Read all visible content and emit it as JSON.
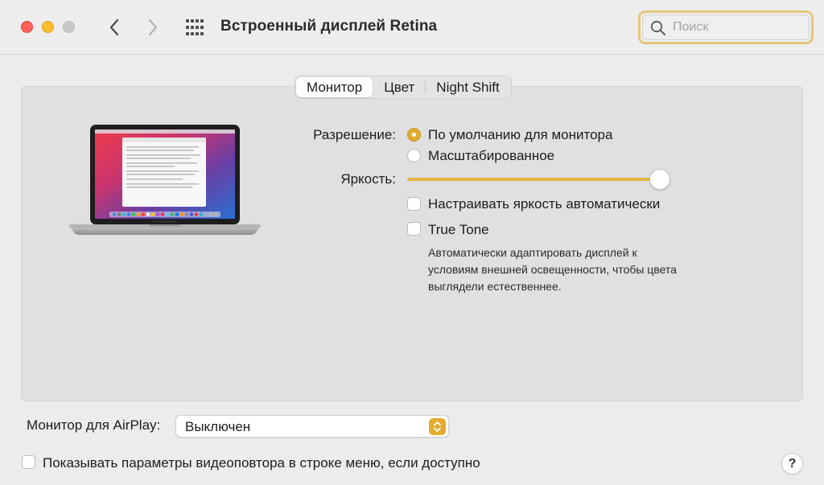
{
  "window": {
    "title": "Встроенный дисплей Retina"
  },
  "search": {
    "placeholder": "Поиск"
  },
  "tabs": [
    {
      "label": "Монитор",
      "active": true
    },
    {
      "label": "Цвет",
      "active": false
    },
    {
      "label": "Night Shift",
      "active": false
    }
  ],
  "resolution": {
    "label": "Разрешение:",
    "options": [
      {
        "label": "По умолчанию для монитора",
        "selected": true
      },
      {
        "label": "Масштабированное",
        "selected": false
      }
    ]
  },
  "brightness": {
    "label": "Яркость:",
    "level": 1.0,
    "auto_label": "Настраивать яркость автоматически",
    "auto_checked": false
  },
  "true_tone": {
    "label": "True Tone",
    "checked": false,
    "description": "Автоматически адаптировать дисплей к условиям внешней освещенности, чтобы цвета выглядели естественнее."
  },
  "airplay": {
    "label": "Монитор для AirPlay:",
    "value": "Выключен"
  },
  "mirroring": {
    "label": "Показывать параметры видеоповтора в строке меню, если доступно",
    "checked": false
  },
  "help": {
    "label": "?"
  },
  "colors": {
    "accent": "#e2ac2f",
    "slider_fill": "#e2b648",
    "search_focus": "#e5c77a"
  },
  "icons": {
    "back": "chevron-left-icon",
    "forward": "chevron-right-icon",
    "grid": "grid-icon",
    "search": "search-icon",
    "popup": "up-down-chevron-icon"
  }
}
